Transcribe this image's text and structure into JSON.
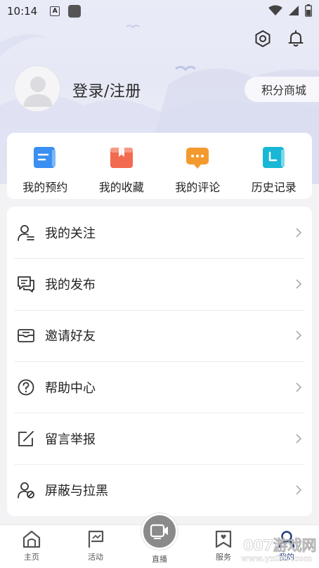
{
  "status_bar": {
    "time": "10:14",
    "a_badge": "A"
  },
  "header": {
    "settings_icon": "hexagon-settings-icon",
    "notification_icon": "bell-icon"
  },
  "profile": {
    "login_text": "登录/注册",
    "points_mall_label": "积分商城"
  },
  "quick_actions": [
    {
      "label": "我的预约",
      "icon": "reservation-icon",
      "color": "#3a8ff0"
    },
    {
      "label": "我的收藏",
      "icon": "favorites-icon",
      "color": "#f26a4f"
    },
    {
      "label": "我的评论",
      "icon": "comment-icon",
      "color": "#f39a2e"
    },
    {
      "label": "历史记录",
      "icon": "history-icon",
      "color": "#19b7d6"
    }
  ],
  "menu": [
    {
      "label": "我的关注",
      "icon": "user-follow-icon"
    },
    {
      "label": "我的发布",
      "icon": "chat-publish-icon"
    },
    {
      "label": "邀请好友",
      "icon": "invite-mail-icon"
    },
    {
      "label": "帮助中心",
      "icon": "help-icon"
    },
    {
      "label": "留言举报",
      "icon": "edit-report-icon"
    },
    {
      "label": "屏蔽与拉黑",
      "icon": "user-block-icon"
    }
  ],
  "tabbar": {
    "home": "主页",
    "activity": "活动",
    "live": "直播",
    "service": "服务",
    "mine": "我的"
  },
  "watermark": {
    "text": "007游戏网",
    "url": "www.yx007.com"
  }
}
